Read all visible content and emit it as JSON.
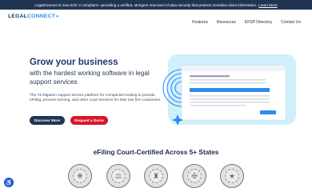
{
  "banner": {
    "text": "LegalConnect is now SOC 2 compliant—providing a verified, stringent new level of data security that protects sensitive client information.",
    "link": "Learn More"
  },
  "logo": {
    "part1": "LEGAL",
    "part2": "CONNECT"
  },
  "nav": {
    "items": [
      "Features",
      "Resources",
      "EFSP Directory",
      "Contact Us"
    ]
  },
  "hero": {
    "title": "Grow your business",
    "subtitle": "with the hardest working software in legal support services",
    "description": "The #1 litigation support service platform for companies looking to provide eFiling, process serving, and other court services for their law firm customers.",
    "primary_button": "Discover More",
    "secondary_button": "Request a Demo"
  },
  "certified": {
    "title": "eFiling Court-Certified Across 5+ States"
  },
  "seals": [
    "state-seal-1",
    "state-seal-2",
    "state-seal-3",
    "state-seal-4",
    "state-seal-5"
  ],
  "colors": {
    "navy": "#1f3552",
    "red": "#d9162a",
    "brand_blue": "#2e8cf0",
    "illustration_bg": "#cfeffb"
  }
}
